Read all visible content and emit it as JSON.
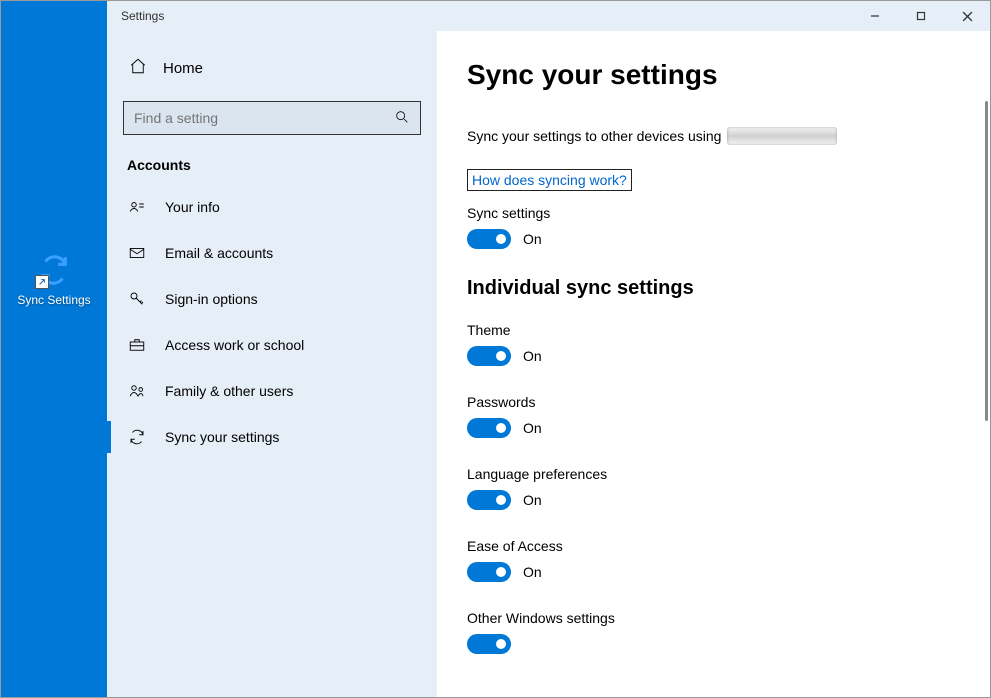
{
  "desktop": {
    "icon_label": "Sync Settings"
  },
  "window": {
    "title": "Settings"
  },
  "sidebar": {
    "home_label": "Home",
    "search_placeholder": "Find a setting",
    "category": "Accounts",
    "items": [
      {
        "label": "Your info"
      },
      {
        "label": "Email & accounts"
      },
      {
        "label": "Sign-in options"
      },
      {
        "label": "Access work or school"
      },
      {
        "label": "Family & other users"
      },
      {
        "label": "Sync your settings"
      }
    ]
  },
  "main": {
    "heading": "Sync your settings",
    "description": "Sync your settings to other devices using",
    "link": "How does syncing work?",
    "sync_label": "Sync settings",
    "sync_state": "On",
    "section2": "Individual sync settings",
    "toggles": [
      {
        "label": "Theme",
        "state": "On"
      },
      {
        "label": "Passwords",
        "state": "On"
      },
      {
        "label": "Language preferences",
        "state": "On"
      },
      {
        "label": "Ease of Access",
        "state": "On"
      },
      {
        "label": "Other Windows settings",
        "state": ""
      }
    ]
  }
}
